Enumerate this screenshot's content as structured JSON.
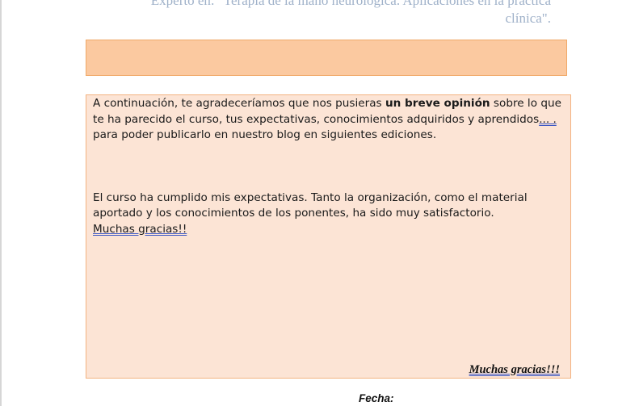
{
  "header": {
    "title_line1": "Experto en: \"Terapia de la mano neurológica. Aplicaciones en la práctica",
    "title_line2": "clínica\"."
  },
  "intro": {
    "text_before": "A continuación, te agradeceríamos que nos pusieras ",
    "bold_text": "un breve opinión",
    "text_after": " sobre lo que te ha parecido el curso, tus expectativas, conocimientos adquiridos y aprendidos",
    "ellipsis": "... .",
    "text_end": " para poder publicarlo en nuestro blog en siguientes ediciones."
  },
  "response": {
    "text": "El curso ha cumplido mis expectativas. Tanto la organización, como el material aportado y los conocimientos de los ponentes, ha sido muy satisfactorio.",
    "thanks": "Muchas gracias!!"
  },
  "footer": {
    "thanks": "Muchas gracias!!!",
    "date_label": "Fecha:"
  },
  "colors": {
    "bar_fill": "#fbc9a0",
    "box_fill": "#fce4d5",
    "box_border": "#f3b381",
    "header_text": "#9fb1c9",
    "underline": "#3b57c4"
  }
}
